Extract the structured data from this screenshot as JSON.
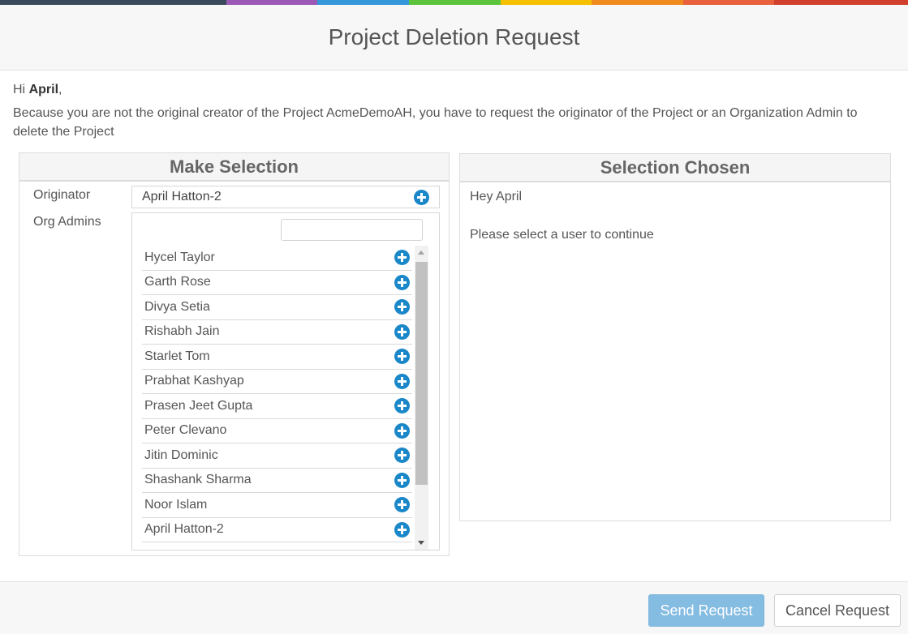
{
  "header": {
    "title": "Project Deletion Request",
    "color_bar": [
      "#3a4a5c",
      "#9b59b6",
      "#3498db",
      "#5cc43c",
      "#f5c000",
      "#ef8a1e",
      "#e8603c",
      "#d0402c"
    ]
  },
  "greeting": {
    "prefix": "Hi ",
    "name": "April",
    "suffix": ","
  },
  "explanation": "Because you are not the original creator of the Project AcmeDemoAH, you have to request the originator of the Project or an Organization Admin to delete the Project",
  "make_selection": {
    "title": "Make Selection",
    "originator_label": "Originator",
    "originator_value": "April Hatton-2",
    "org_admins_label": "Org Admins",
    "search_value": "",
    "admins": [
      "Hycel Taylor",
      "Garth Rose",
      "Divya Setia",
      "Rishabh Jain",
      "Starlet Tom",
      "Prabhat Kashyap",
      "Prasen Jeet Gupta",
      "Peter Clevano",
      "Jitin Dominic",
      "Shashank Sharma",
      "Noor Islam",
      "April Hatton-2"
    ]
  },
  "selection_chosen": {
    "title": "Selection Chosen",
    "greeting": "Hey April",
    "message": "Please select a user to continue"
  },
  "footer": {
    "send_label": "Send Request",
    "cancel_label": "Cancel Request"
  },
  "icons": {
    "add": "plus-circle-icon"
  },
  "colors": {
    "accent": "#1a87c9",
    "send_button": "#84bce2"
  }
}
